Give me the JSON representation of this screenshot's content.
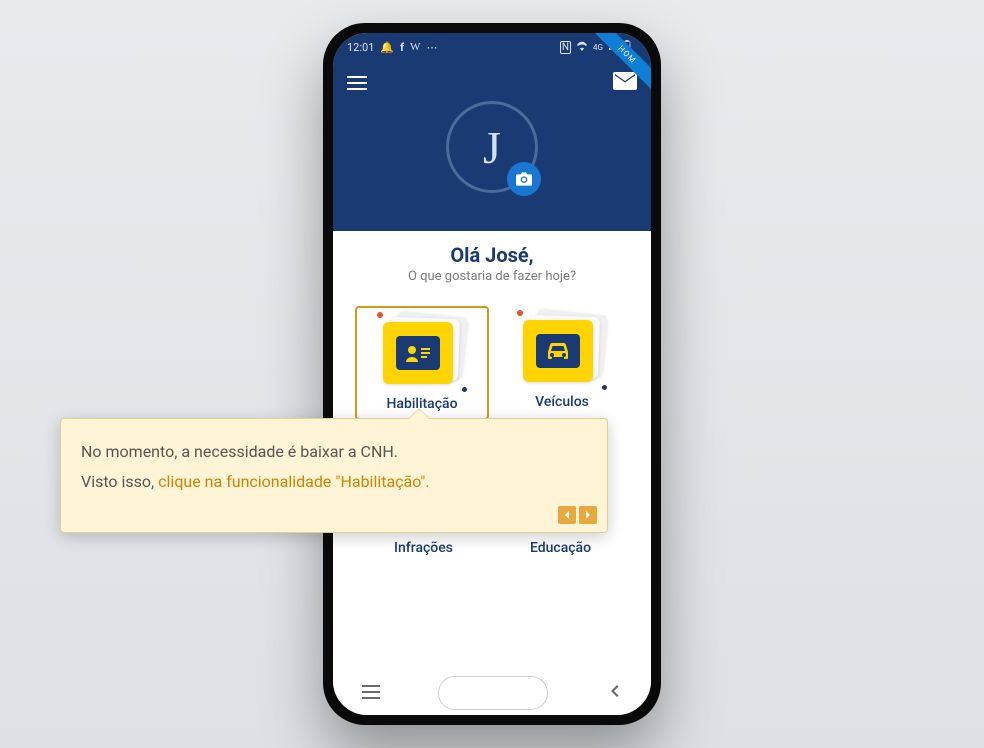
{
  "statusbar": {
    "time": "12:01",
    "network_label": "4G"
  },
  "ribbon": {
    "text": "HOM"
  },
  "avatar": {
    "initial": "J"
  },
  "greeting": {
    "title": "Olá José,",
    "subtitle": "O que gostaria de fazer hoje?"
  },
  "tiles": {
    "habilitacao": {
      "label": "Habilitação"
    },
    "veiculos": {
      "label": "Veículos"
    },
    "infracoes": {
      "label": "Infrações"
    },
    "educacao": {
      "label": "Educação"
    }
  },
  "tooltip": {
    "line1": "No momento, a necessidade é baixar a CNH.",
    "line2_prefix": "Visto isso, ",
    "line2_accent": "clique na funcionalidade \"Habilitação\"."
  }
}
